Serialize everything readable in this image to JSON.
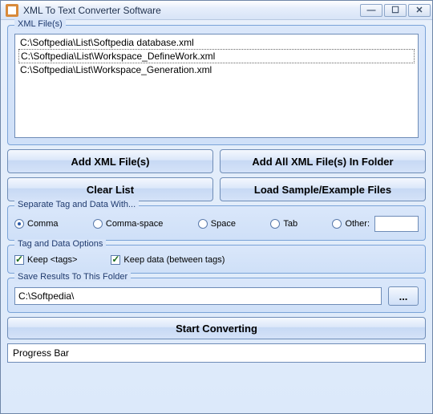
{
  "window": {
    "title": "XML To Text Converter Software"
  },
  "file_group": {
    "title": "XML File(s)",
    "items": [
      "C:\\Softpedia\\List\\Softpedia database.xml",
      "C:\\Softpedia\\List\\Workspace_DefineWork.xml",
      "C:\\Softpedia\\List\\Workspace_Generation.xml"
    ],
    "selected_index": 1
  },
  "buttons": {
    "add_files": "Add XML File(s)",
    "add_folder": "Add All XML File(s) In Folder",
    "clear_list": "Clear List",
    "load_sample": "Load Sample/Example Files",
    "browse": "...",
    "start": "Start Converting"
  },
  "separator_group": {
    "title": "Separate Tag and Data With...",
    "options": {
      "comma": "Comma",
      "comma_space": "Comma-space",
      "space": "Space",
      "tab": "Tab",
      "other": "Other:"
    },
    "selected": "comma",
    "other_value": ""
  },
  "options_group": {
    "title": "Tag and Data Options",
    "keep_tags_label": "Keep <tags>",
    "keep_tags_checked": true,
    "keep_data_label": "Keep data (between tags)",
    "keep_data_checked": true
  },
  "save_group": {
    "title": "Save Results To This Folder",
    "path": "C:\\Softpedia\\"
  },
  "progress": {
    "label": "Progress Bar"
  }
}
